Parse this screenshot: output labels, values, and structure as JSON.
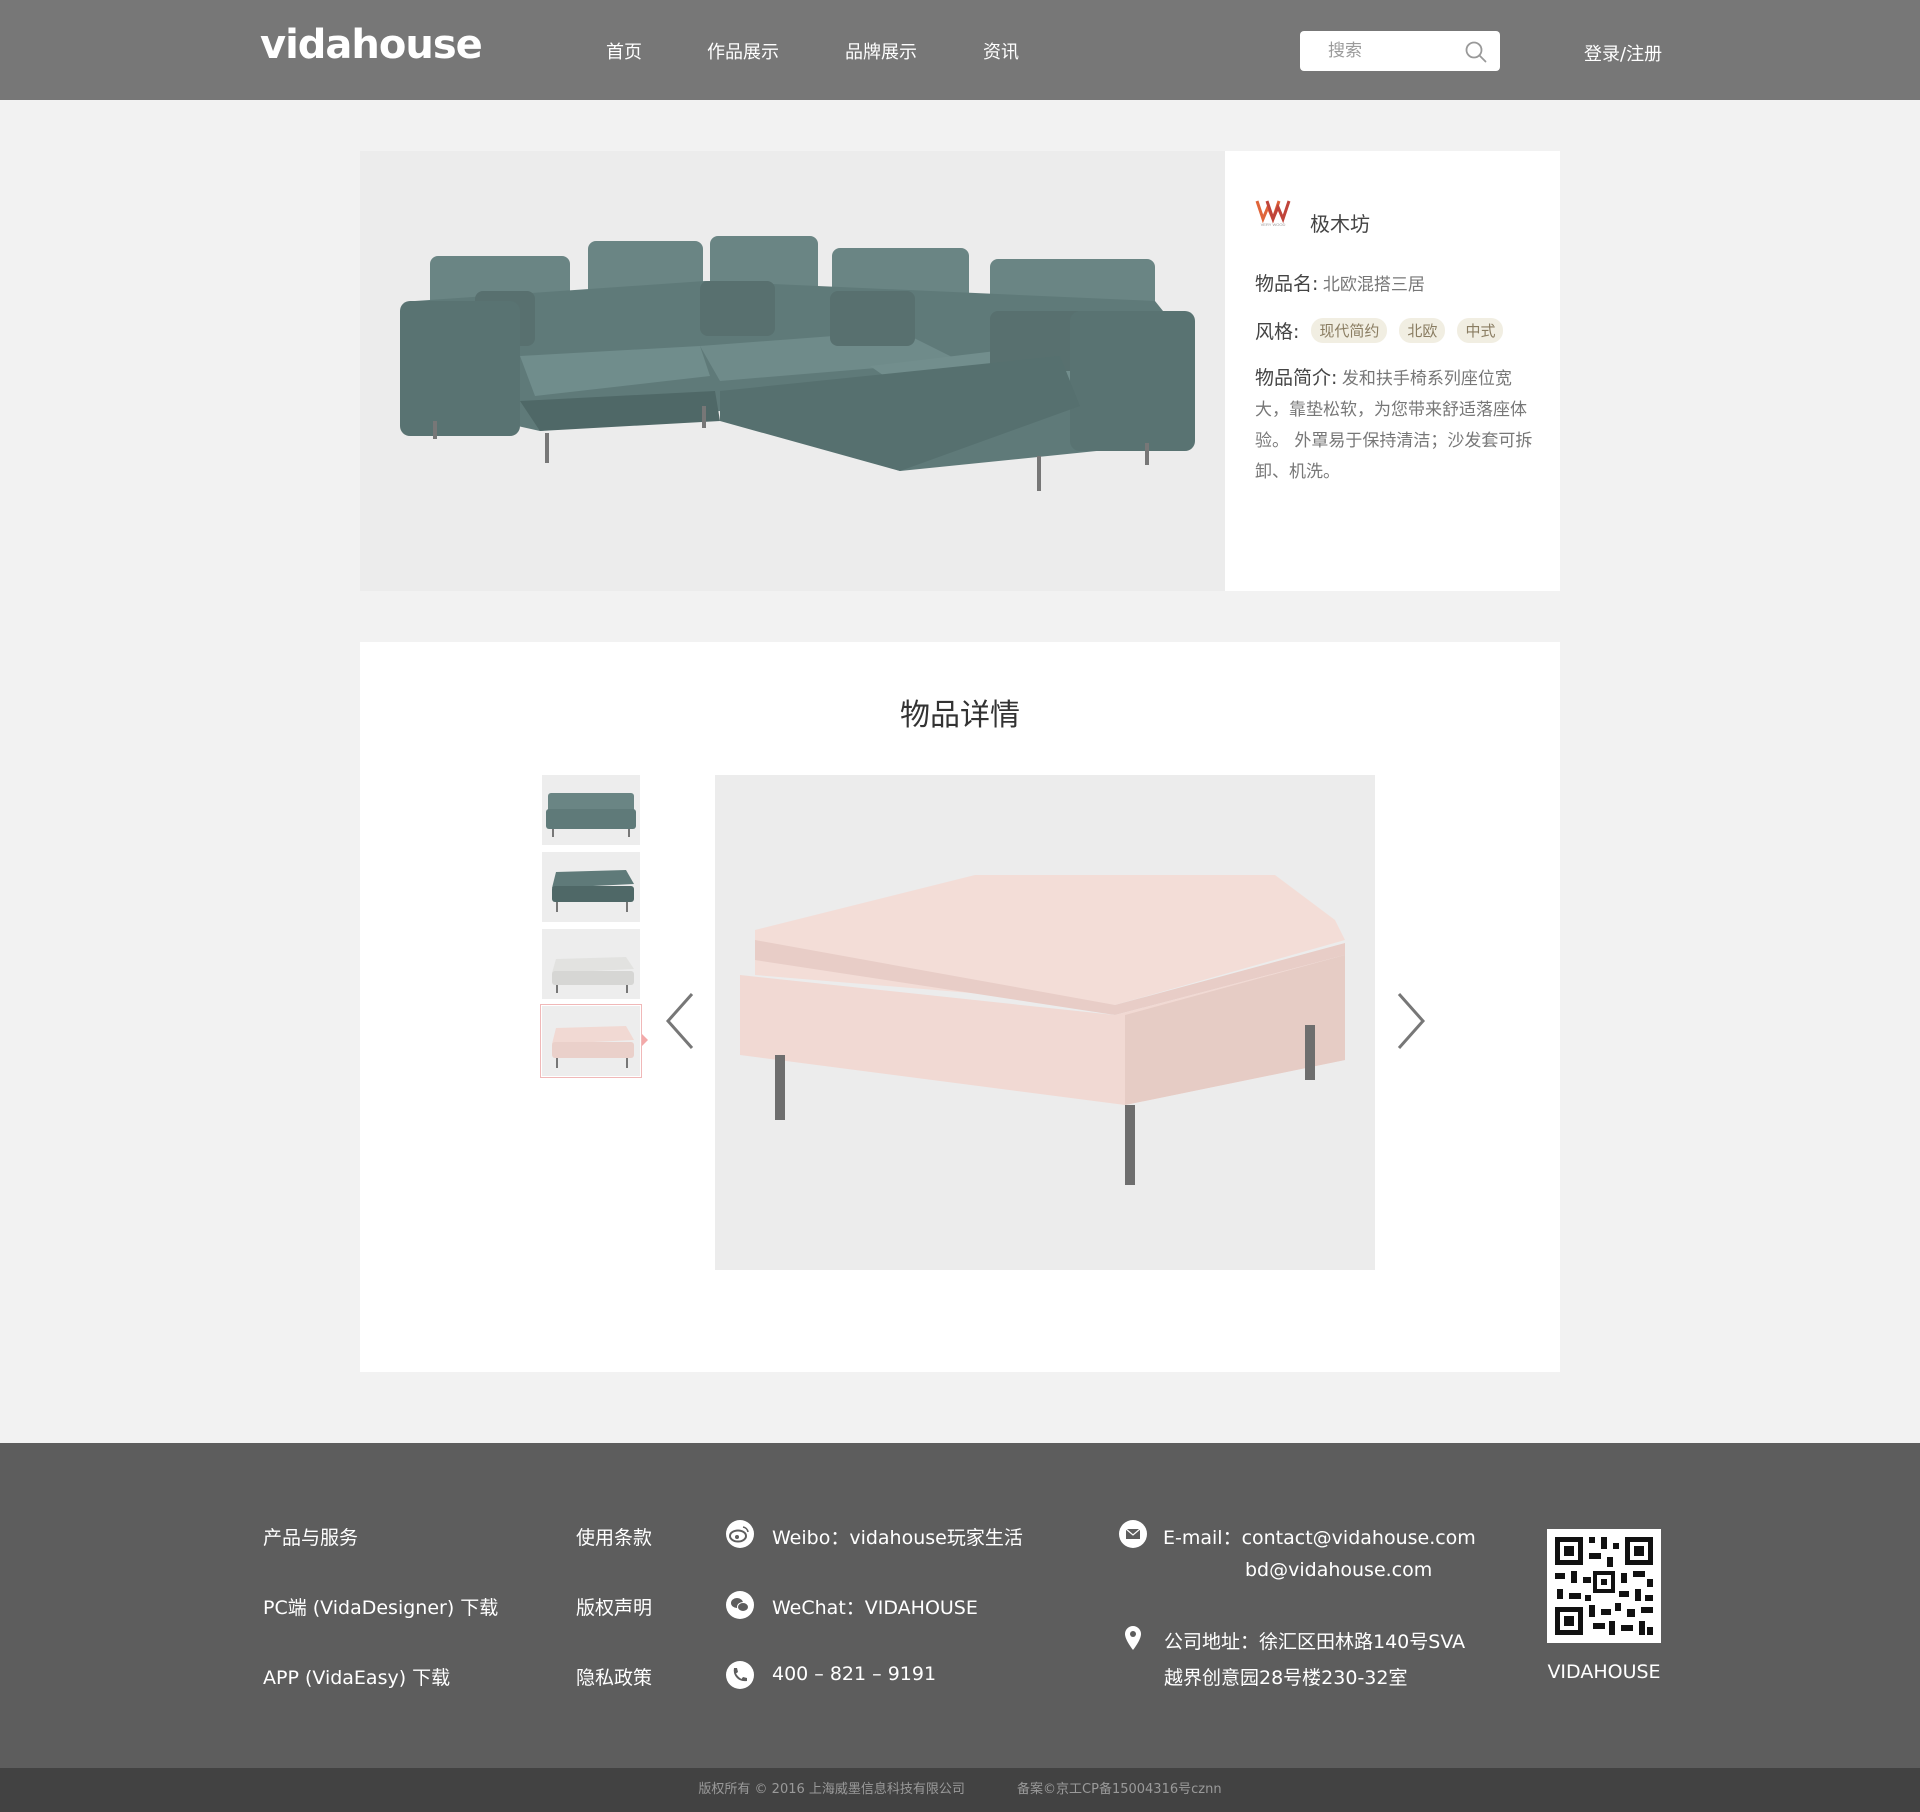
{
  "header": {
    "logo": "vidahouse",
    "nav": [
      "首页",
      "作品展示",
      "品牌展示",
      "资讯"
    ],
    "search_placeholder": "搜索",
    "login": "登录/注册"
  },
  "product": {
    "brand_logo_text": "VERY WOOD",
    "brand": "极木坊",
    "name_label": "物品名:",
    "name_value": "北欧混搭三居",
    "style_label": "风格:",
    "styles": [
      "现代简约",
      "北欧",
      "中式"
    ],
    "desc_label": "物品简介:",
    "desc_value": "发和扶手椅系列座位宽大，靠垫松软，为您带来舒适落座体验。 外罩易于保持清洁；沙发套可拆卸、机洗。"
  },
  "detail": {
    "title": "物品详情",
    "active_thumb": 4
  },
  "footer": {
    "col1": [
      "产品与服务",
      "PC端 (VidaDesigner) 下载",
      "APP (VidaEasy) 下载"
    ],
    "col2": [
      "使用条款",
      "版权声明",
      "隐私政策"
    ],
    "weibo": "Weibo：vidahouse玩家生活",
    "wechat": "WeChat：VIDAHOUSE",
    "phone": "400 – 821 – 9191",
    "email_line1": "E-mail：contact@vidahouse.com",
    "email_line2": "bd@vidahouse.com",
    "address_line1": "公司地址：徐汇区田林路140号SVA",
    "address_line2": "越界创意园28号楼230-32室",
    "qr_label": "VIDAHOUSE"
  },
  "copyright": {
    "left": "版权所有 © 2016 上海威墨信息科技有限公司",
    "right": "备案©京工CP备15004316号cznn"
  },
  "colors": {
    "header_bg": "#777777",
    "footer_bg": "#5d5d5d",
    "copyright_bg": "#424242",
    "sofa": "#5f7a79",
    "ottoman": "#f1d9d3",
    "tag_bg": "#f1eee2"
  }
}
